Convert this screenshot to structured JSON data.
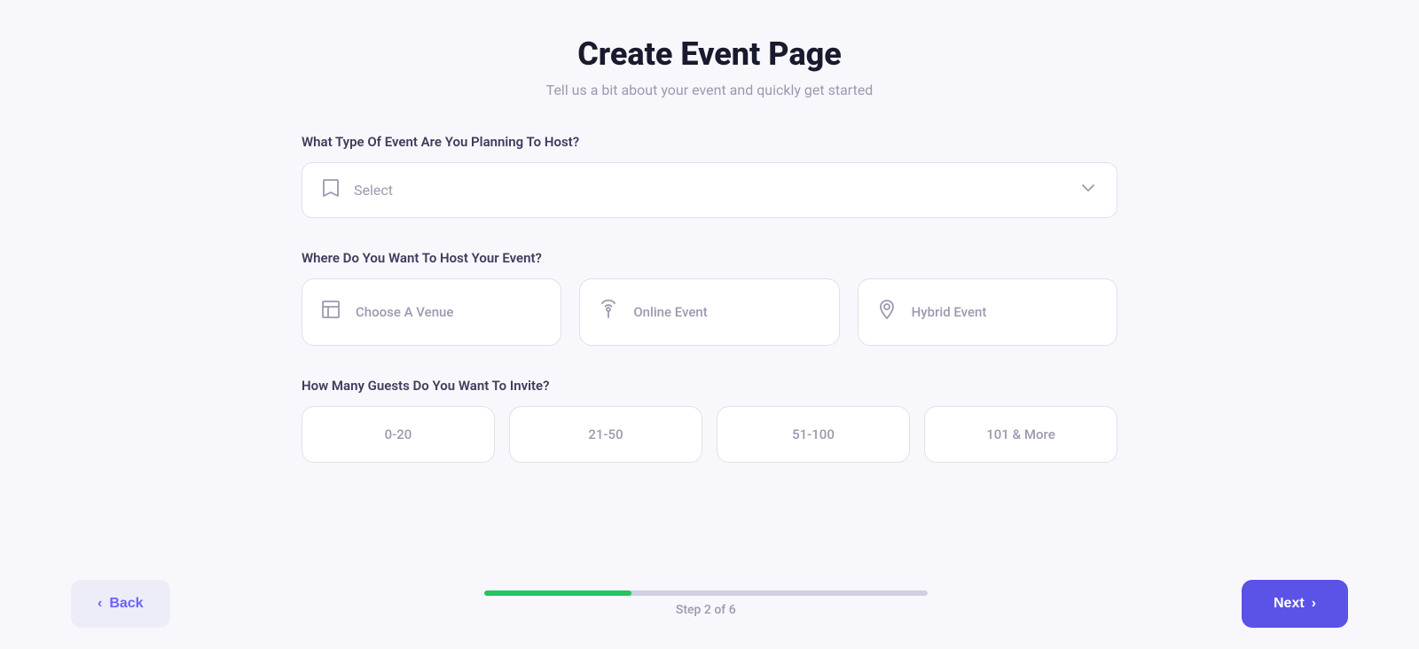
{
  "header": {
    "title": "Create Event Page",
    "subtitle": "Tell us a bit about your event and quickly get started"
  },
  "sections": {
    "event_type": {
      "label": "What Type Of Event Are You Planning To Host?",
      "select_placeholder": "Select"
    },
    "host_location": {
      "label": "Where Do You Want To Host Your Event?",
      "options": [
        {
          "id": "venue",
          "label": "Choose A Venue"
        },
        {
          "id": "online",
          "label": "Online Event"
        },
        {
          "id": "hybrid",
          "label": "Hybrid Event"
        }
      ]
    },
    "guest_count": {
      "label": "How Many Guests Do You Want To Invite?",
      "options": [
        {
          "id": "0-20",
          "label": "0-20"
        },
        {
          "id": "21-50",
          "label": "21-50"
        },
        {
          "id": "51-100",
          "label": "51-100"
        },
        {
          "id": "101+",
          "label": "101 & More"
        }
      ]
    }
  },
  "footer": {
    "back_label": "Back",
    "next_label": "Next",
    "progress_text": "Step 2 of 6",
    "progress_percent": 33.3
  }
}
